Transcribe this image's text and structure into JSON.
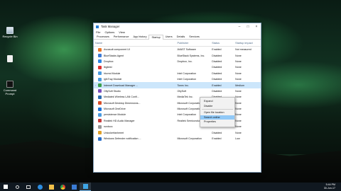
{
  "desktop": {
    "icons": [
      {
        "label": "Recycle Bin"
      },
      {
        "label": ""
      },
      {
        "label": "Command Prompt"
      }
    ]
  },
  "window": {
    "title": "Task Manager",
    "menu": [
      "File",
      "Options",
      "View"
    ],
    "tabs": [
      "Processes",
      "Performance",
      "App history",
      "Startup",
      "Users",
      "Details",
      "Services"
    ],
    "active_tab": "Startup",
    "columns": {
      "name": "Name",
      "publisher": "Publisher",
      "status": "Status",
      "impact": "Startup impact"
    },
    "rows": [
      {
        "name": "Avcasuit component UI",
        "publisher": "AVAST Software",
        "status": "Enabled",
        "impact": "Not measured",
        "color": "#e8762b"
      },
      {
        "name": "BlueStacks Agent",
        "publisher": "BlueStack Systems, Inc.",
        "status": "Disabled",
        "impact": "None",
        "color": "#3d7ad6"
      },
      {
        "name": "Dropbox",
        "publisher": "Dropbox, Inc.",
        "status": "Disabled",
        "impact": "None",
        "color": "#2f86e5"
      },
      {
        "name": "ibgbest",
        "publisher": "",
        "status": "Disabled",
        "impact": "None",
        "color": "#d33"
      },
      {
        "name": "hkcmd Module",
        "publisher": "Intel Corporation",
        "status": "Disabled",
        "impact": "None",
        "color": "#4a9be0"
      },
      {
        "name": "igfxTray Module",
        "publisher": "Intel Corporation",
        "status": "Disabled",
        "impact": "None",
        "color": "#4a9be0"
      },
      {
        "name": "Internet Download Manager ...",
        "publisher": "Tonec Inc.",
        "status": "Enabled",
        "impact": "Medium",
        "color": "#3aa04a"
      },
      {
        "name": "OllySoft Studio",
        "publisher": "OllySoft",
        "status": "Disabled",
        "impact": "None",
        "color": "#7a4fbf"
      },
      {
        "name": "Mediatek Wireless LAN Confi...",
        "publisher": "MediaTek Inc.",
        "status": "Disabled",
        "impact": "None",
        "color": "#2c6cb0"
      },
      {
        "name": "Microsoft Desktop Dimensions...",
        "publisher": "Microsoft Corporation",
        "status": "Disabled",
        "impact": "None",
        "color": "#d9502a"
      },
      {
        "name": "Microsoft OneDrive",
        "publisher": "Microsoft Corporation",
        "status": "Disabled",
        "impact": "None",
        "color": "#1e73d8"
      },
      {
        "name": "persistence Module",
        "publisher": "Intel Corporation",
        "status": "Disabled",
        "impact": "None",
        "color": "#4a9be0"
      },
      {
        "name": "Realtek HD Audio Manager",
        "publisher": "Realtek Semiconductor",
        "status": "Disabled",
        "impact": "None",
        "color": "#c83b3b"
      },
      {
        "name": "rundsvc",
        "publisher": "",
        "status": "Disabled",
        "impact": "None",
        "color": "#999"
      },
      {
        "name": "Unlockerfanheeet",
        "publisher": "",
        "status": "Disabled",
        "impact": "None",
        "color": "#e0a028"
      },
      {
        "name": "Windows Defender notification ...",
        "publisher": "Microsoft Corporation",
        "status": "Enabled",
        "impact": "Low",
        "color": "#2a6fc9"
      }
    ],
    "context_menu": [
      "Expand",
      "Disable",
      "Open file location",
      "Search online",
      "Properties"
    ],
    "context_menu_highlight": "Search online"
  },
  "taskbar": {
    "time": "5:44 PM",
    "date": "30-Jun-17"
  }
}
